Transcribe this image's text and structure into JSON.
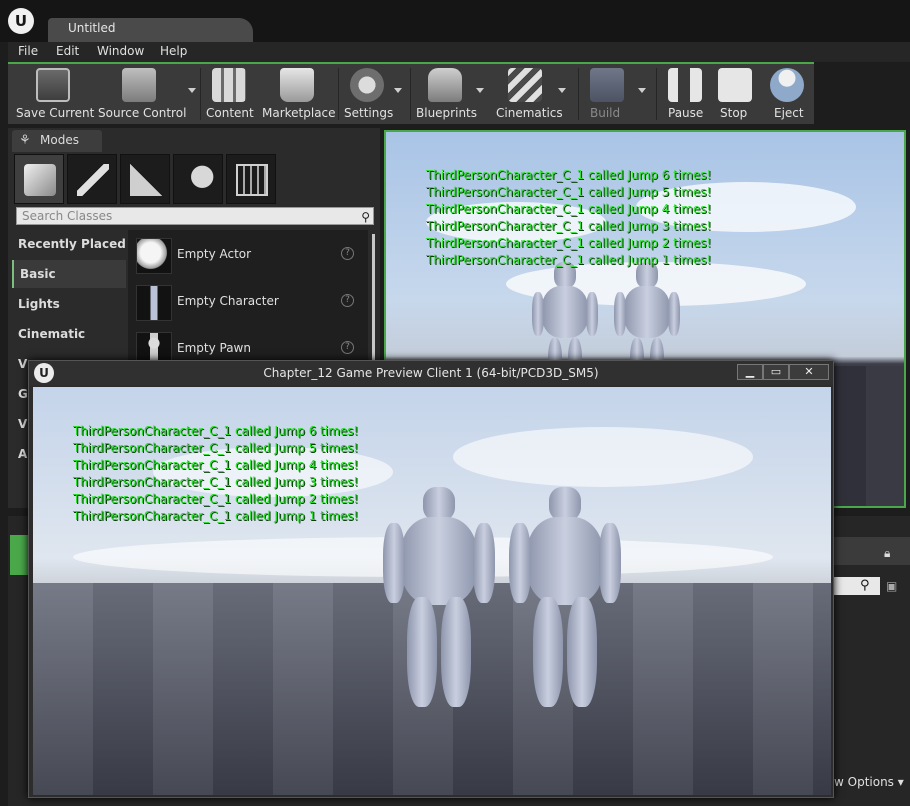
{
  "editor": {
    "tab_title": "Untitled",
    "menu": [
      "File",
      "Edit",
      "Window",
      "Help"
    ],
    "toolbar": [
      {
        "label": "Save Current",
        "icon": "save-icon",
        "dropdown": false
      },
      {
        "label": "Source Control",
        "icon": "source-control-icon",
        "dropdown": true
      },
      {
        "label": "Content",
        "icon": "content-icon",
        "dropdown": false
      },
      {
        "label": "Marketplace",
        "icon": "marketplace-icon",
        "dropdown": false
      },
      {
        "label": "Settings",
        "icon": "settings-icon",
        "dropdown": true
      },
      {
        "label": "Blueprints",
        "icon": "blueprints-icon",
        "dropdown": true
      },
      {
        "label": "Cinematics",
        "icon": "cinematics-icon",
        "dropdown": true
      },
      {
        "label": "Build",
        "icon": "build-icon",
        "dropdown": true
      },
      {
        "label": "Pause",
        "icon": "pause-icon",
        "dropdown": false
      },
      {
        "label": "Stop",
        "icon": "stop-icon",
        "dropdown": false
      },
      {
        "label": "Eject",
        "icon": "eject-icon",
        "dropdown": false
      }
    ],
    "modes": {
      "tab_label": "Modes",
      "search_placeholder": "Search Classes",
      "categories": [
        "Recently Placed",
        "Basic",
        "Lights",
        "Cinematic",
        "V",
        "G",
        "V",
        "A"
      ],
      "active_category": "Basic",
      "items": [
        "Empty Actor",
        "Empty Character",
        "Empty Pawn"
      ]
    },
    "details": {
      "view_options": "w Options"
    }
  },
  "viewport_messages": [
    "ThirdPersonCharacter_C_1 called Jump 6 times!",
    "ThirdPersonCharacter_C_1 called Jump 5 times!",
    "ThirdPersonCharacter_C_1 called Jump 4 times!",
    "ThirdPersonCharacter_C_1 called Jump 3 times!",
    "ThirdPersonCharacter_C_1 called Jump 2 times!",
    "ThirdPersonCharacter_C_1 called Jump 1 times!"
  ],
  "preview_window": {
    "title": "Chapter_12 Game Preview Client 1 (64-bit/PCD3D_SM5)",
    "minimize": "▁",
    "maximize": "▭",
    "close": "✕"
  },
  "colors": {
    "message_green": "#22dd22",
    "active_border": "#4aa84a"
  }
}
